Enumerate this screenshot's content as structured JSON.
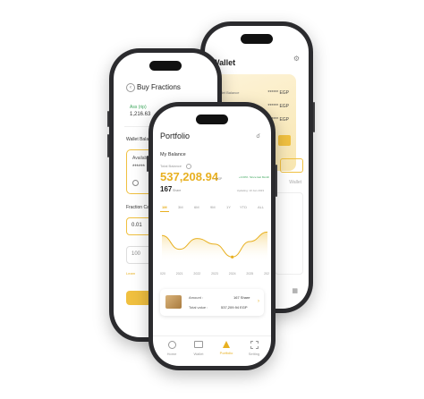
{
  "wallet": {
    "title": "Wallet",
    "masked_values": [
      "****** EGP",
      "****** EGP",
      "****** EGP"
    ],
    "row_labels": [
      "Wallet Balance",
      "Available Balance"
    ],
    "side_labels": [
      "Wallet",
      "Wallet"
    ]
  },
  "buy": {
    "title": "Buy Fractions",
    "back_icon": "chevron-left-icon",
    "asset_label": "Ass (rip)",
    "asset_value": "1,216.63",
    "wallet_balance_label": "Wallet Balance",
    "available_label": "Available",
    "masked": "******",
    "section_label": "Fraction Calc",
    "input_value": "0.01",
    "input2_value": "100",
    "link_text": "Learn"
  },
  "portfolio": {
    "title": "Portfolio",
    "balance_label": "My Balance",
    "balance_sub": "Total Balance",
    "balance": "537,208.94",
    "currency": "EGP",
    "change": "+0.00% ",
    "change_period": "Since last Month",
    "shares": "167",
    "shares_unit": "Share",
    "updated": "Updating: 10 Jan 2023",
    "periods": [
      "1M",
      "3M",
      "6M",
      "9M",
      "1Y",
      "YTD",
      "ALL"
    ],
    "x_ticks": [
      "2020",
      "2021",
      "2022",
      "2023",
      "2024",
      "2025",
      "2026"
    ],
    "holding": {
      "amount_label": "Amount :",
      "amount_value": "167 Share",
      "total_label": "Total value :",
      "total_value": "537,209.94 EGP"
    },
    "nav": [
      "Home",
      "Wallet",
      "Portfolio",
      "Setting"
    ],
    "nav_icons": [
      "home-icon",
      "wallet-icon",
      "portfolio-icon",
      "setting-icon"
    ],
    "active_nav": "Portfolio",
    "accent": "#e8b020"
  },
  "chart_data": {
    "type": "area",
    "x": [
      "2020",
      "2021",
      "2022",
      "2023",
      "2024",
      "2025",
      "2026"
    ],
    "series": [
      {
        "values": [
          0.62,
          0.3,
          0.55,
          0.42,
          0.12,
          0.48,
          0.7
        ]
      }
    ],
    "ylim": [
      0,
      1
    ]
  }
}
